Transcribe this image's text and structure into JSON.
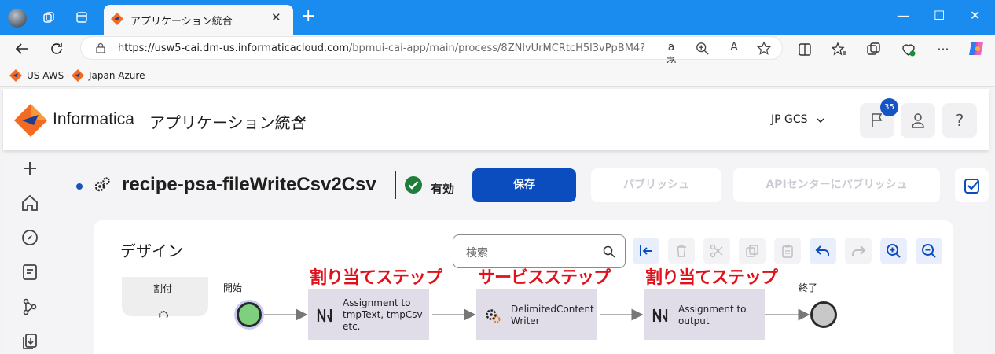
{
  "browser": {
    "tab_title": "アプリケーション統合",
    "url_host": "https://usw5-cai.dm-us.informaticacloud.com",
    "url_path": "/bpmui-cai-app/main/process/8ZNlvUrMCRtcH5l3vPpBM4?mo...",
    "favorites": [
      "US AWS",
      "Japan Azure"
    ],
    "window_controls": {
      "minimize": "—",
      "maximize": "☐",
      "close": "✕"
    }
  },
  "header": {
    "brand": "Informatica",
    "app_name": "アプリケーション統合",
    "org": "JP GCS",
    "notification_count": "35"
  },
  "process": {
    "name": "recipe-psa-fileWriteCsv2Csv",
    "status": "有効",
    "save_label": "保存",
    "publish_label": "パブリッシュ",
    "publish_api_label": "APIセンターにパブリッシュ"
  },
  "design": {
    "title": "デザイン",
    "search_placeholder": "検索",
    "assign_label": "割付",
    "start_label": "開始",
    "end_label": "終了",
    "steps": [
      {
        "lines": [
          "Assignment to",
          "tmpText, tmpCsv",
          "etc."
        ],
        "icon": "assignment-icon"
      },
      {
        "lines": [
          "DelimitedContent",
          "Writer"
        ],
        "icon": "service-gear-icon"
      },
      {
        "lines": [
          "Assignment to",
          "output"
        ],
        "icon": "assignment-icon"
      }
    ],
    "annotations": [
      "割り当てステップ",
      "サービスステップ",
      "割り当てステップ"
    ]
  },
  "colors": {
    "tab_strip": "#1a8cf0",
    "primary": "#0b4dbe",
    "annotation": "#e2101b",
    "step_fill": "#e1dde8",
    "start_node": "#7ed07e"
  }
}
